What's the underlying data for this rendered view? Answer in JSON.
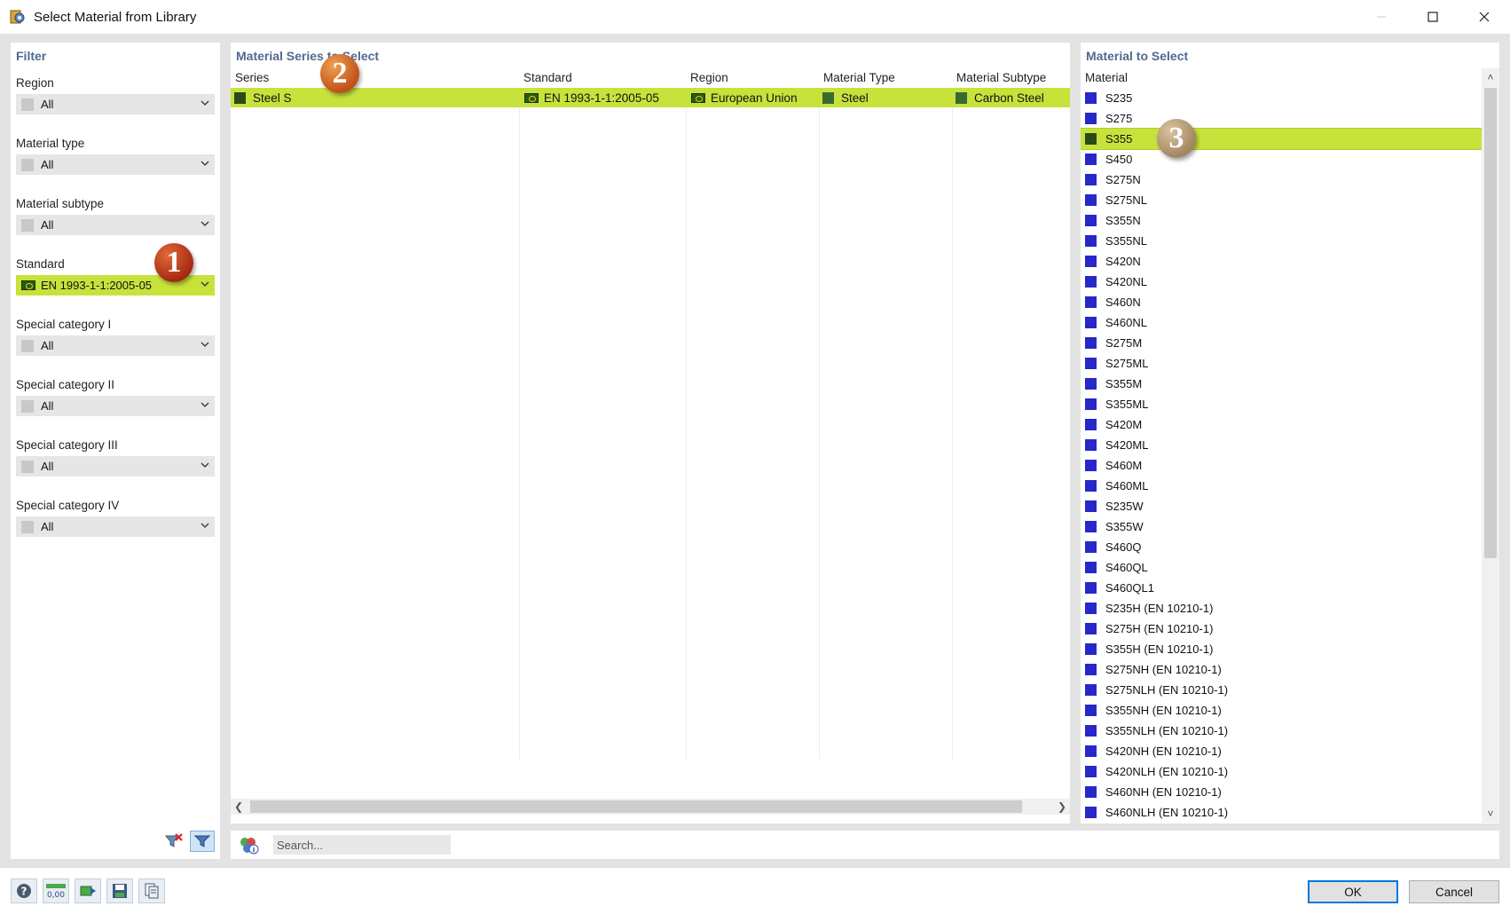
{
  "window": {
    "title": "Select Material from Library"
  },
  "filter": {
    "title": "Filter",
    "groups": [
      {
        "label": "Region",
        "value": "All"
      },
      {
        "label": "Material type",
        "value": "All"
      },
      {
        "label": "Material subtype",
        "value": "All"
      },
      {
        "label": "Standard",
        "value": "EN 1993-1-1:2005-05"
      },
      {
        "label": "Special category I",
        "value": "All"
      },
      {
        "label": "Special category II",
        "value": "All"
      },
      {
        "label": "Special category III",
        "value": "All"
      },
      {
        "label": "Special category IV",
        "value": "All"
      }
    ]
  },
  "markers": {
    "one": "1",
    "two": "2",
    "three": "3"
  },
  "series": {
    "title": "Material Series to Select",
    "columns": [
      "Series",
      "Standard",
      "Region",
      "Material Type",
      "Material Subtype"
    ],
    "row": {
      "series": "Steel S",
      "standard": "EN 1993-1-1:2005-05",
      "region": "European Union",
      "material_type": "Steel",
      "material_subtype": "Carbon Steel"
    }
  },
  "materials": {
    "title": "Material to Select",
    "column": "Material",
    "selected": "S355",
    "items": [
      "S235",
      "S275",
      "S355",
      "S450",
      "S275N",
      "S275NL",
      "S355N",
      "S355NL",
      "S420N",
      "S420NL",
      "S460N",
      "S460NL",
      "S275M",
      "S275ML",
      "S355M",
      "S355ML",
      "S420M",
      "S420ML",
      "S460M",
      "S460ML",
      "S235W",
      "S355W",
      "S460Q",
      "S460QL",
      "S460QL1",
      "S235H (EN 10210-1)",
      "S275H (EN 10210-1)",
      "S355H (EN 10210-1)",
      "S275NH (EN 10210-1)",
      "S275NLH (EN 10210-1)",
      "S355NH (EN 10210-1)",
      "S355NLH (EN 10210-1)",
      "S420NH (EN 10210-1)",
      "S420NLH (EN 10210-1)",
      "S460NH (EN 10210-1)",
      "S460NLH (EN 10210-1)"
    ]
  },
  "search": {
    "placeholder": "Search..."
  },
  "buttons": {
    "ok": "OK",
    "cancel": "Cancel"
  },
  "colors": {
    "highlight": "#c8e23c",
    "material_swatch": "#2828c8",
    "panel_title": "#4f6a8f",
    "ok_border": "#0078d7"
  }
}
